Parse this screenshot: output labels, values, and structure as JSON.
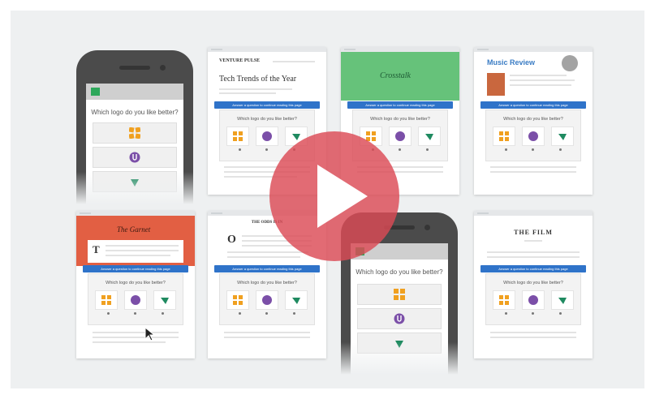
{
  "survey": {
    "banner": "Answer a question to continue reading this page",
    "question": "Which logo do you like better?"
  },
  "phone_question": "Which logo do you like better?",
  "publications": {
    "venture": "VENTURE PULSE",
    "tech_title": "Tech Trends of the Year",
    "crossfield": "Crosstalk",
    "music": "Music Review",
    "orange": "The Garnet",
    "odds": "THE ODDS IS IN",
    "film": "THE FILM",
    "dropcap_t": "T",
    "dropcap_o": "O"
  },
  "colors": {
    "stage": "#eef0f1",
    "banner_blue": "#2f73c9",
    "play_red": "#dc4b55",
    "logo_orange": "#f0a020",
    "logo_purple": "#7b4fa8",
    "logo_green": "#1f8a60",
    "green_header": "#66c27a",
    "orange_header": "#e25f43"
  },
  "icons": [
    "play-icon",
    "cursor-icon",
    "logo-orange-pinwheel-icon",
    "logo-purple-circle-icon",
    "logo-green-leaf-icon"
  ]
}
